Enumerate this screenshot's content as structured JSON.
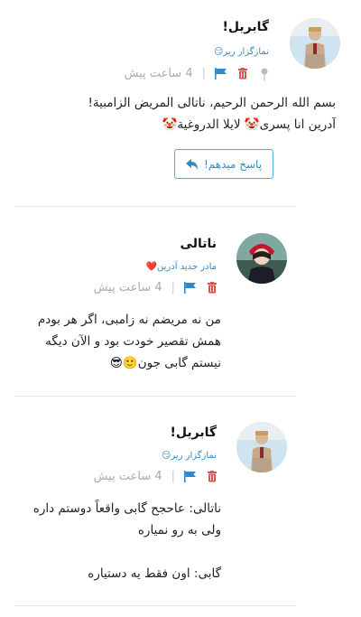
{
  "posts": [
    {
      "author": "گابریل!",
      "rank": "نمازگزار ریر😏",
      "time": "4 ساعت پیش",
      "body": "بسم الله الرحمن الرحیم، ناتالی المریض الزامبیة!\nآدرین انا پسری🤡 لایلا الدروغیة🤡",
      "reply_label": "پاسخ میدهم!"
    },
    {
      "author": "ناتالی",
      "rank": "مادر جدید آدرین❤️",
      "time": "4 ساعت پیش",
      "body": "من نه مریضم نه زامبی، اگر هر بودم\nهمش تقصیر خودت بود و الآن دیگه\nنیستم گابی جون🙂😎"
    },
    {
      "author": "گابریل!",
      "rank": "نمازگزار ریر😏",
      "time": "4 ساعت پیش",
      "body": "ناتالی: عاحجح گابی واقعاً دوستم داره\nولی به رو نمیاره\n\nگابی: اون فقط یه دستیاره"
    }
  ],
  "colors": {
    "accent": "#2e8bc9",
    "delete": "#d9534f",
    "pin": "#bbbbbb",
    "muted": "#aaaaaa"
  },
  "icons": [
    "pin-icon",
    "delete-icon",
    "flag-icon",
    "reply-icon"
  ]
}
